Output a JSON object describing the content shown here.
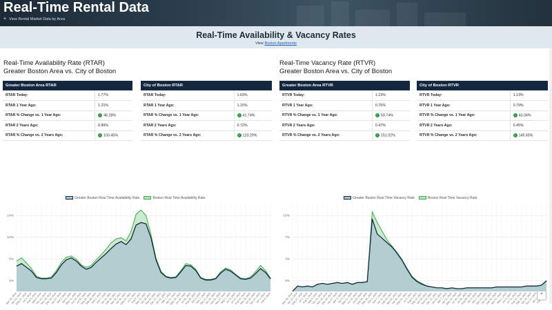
{
  "hero": {
    "title": "Real-Time Rental Data",
    "subtitle": "View Rental Market Data by Area"
  },
  "section": {
    "title": "Real-Time Availability & Vacancy Rates",
    "view_prefix": "View",
    "view_link": "Boston Apartments"
  },
  "rtar": {
    "heading_line1": "Real-Time Availability Rate (RTAR)",
    "heading_line2": "Greater Boston Area vs. City of Boston",
    "tables": [
      {
        "header": "Greater Boston Area RTAR",
        "rows": [
          {
            "label": "RTAR Today:",
            "value": "1.77%"
          },
          {
            "label": "RTAR 1 Year Ago:",
            "value": "1.21%"
          },
          {
            "label": "RTAR % Change vs. 1 Year Ago:",
            "value": "46.28%"
          },
          {
            "label": "RTAR 2 Years Ago:",
            "value": "0.86%"
          },
          {
            "label": "RTAR % Change vs. 2 Years Ago:",
            "value": "103.45%"
          }
        ]
      },
      {
        "header": "City of Boston RTAR",
        "rows": [
          {
            "label": "RTAR Today:",
            "value": "1.63%"
          },
          {
            "label": "RTAR 1 Year Ago:",
            "value": "1.15%"
          },
          {
            "label": "RTAR % Change vs. 1 Year Ago:",
            "value": "41.74%"
          },
          {
            "label": "RTAR 2 Years Ago:",
            "value": "0.72%"
          },
          {
            "label": "RTAR % Change vs. 2 Years Ago:",
            "value": "123.29%"
          }
        ]
      }
    ]
  },
  "rtvr": {
    "heading_line1": "Real-Time Vacancy Rate (RTVR)",
    "heading_line2": "Greater Boston Area vs. City of Boston",
    "tables": [
      {
        "header": "Greater Boston Area RTVR",
        "rows": [
          {
            "label": "RTVR Today:",
            "value": "1.23%"
          },
          {
            "label": "RTVR 1 Year Ago:",
            "value": "0.76%"
          },
          {
            "label": "RTVR % Change vs. 1 Year Ago:",
            "value": "59.74%"
          },
          {
            "label": "RTVR 2 Years Ago:",
            "value": "0.47%"
          },
          {
            "label": "RTVR % Change vs. 2 Years Ago:",
            "value": "151.02%"
          }
        ]
      },
      {
        "header": "City of Boston RTVR",
        "rows": [
          {
            "label": "RTVR Today:",
            "value": "1.13%"
          },
          {
            "label": "RTVR 1 Year Ago:",
            "value": "0.79%"
          },
          {
            "label": "RTVR % Change vs. 1 Year Ago:",
            "value": "43.04%"
          },
          {
            "label": "RTVR 2 Years Ago:",
            "value": "0.45%"
          },
          {
            "label": "RTVR % Change vs. 2 Years Ago:",
            "value": "145.65%"
          }
        ]
      }
    ]
  },
  "colors": {
    "greater_line": "#13283f",
    "greater_fill": "#a9c4d0",
    "boston_line": "#3daa4a",
    "boston_fill": "#b9e3bf",
    "table_header": "#13283f",
    "positive": "#2e9a44"
  },
  "chart_data": [
    {
      "type": "area",
      "ytick_labels": [
        "2%",
        "6%",
        "10%",
        "14%"
      ],
      "ylim": [
        0,
        14
      ],
      "grid": true,
      "legend_position": "top",
      "x": [
        "Mar 18, 2019",
        "Apr 22, 2019",
        "May 27, 2019",
        "Jul 1, 2019",
        "Aug 5, 2019",
        "Sep 9, 2019",
        "Oct 14, 2019",
        "Nov 18, 2019",
        "Dec 23, 2019",
        "Jan 27, 2020",
        "Mar 2, 2020",
        "Apr 6, 2020",
        "May 11, 2020",
        "Jun 15, 2020",
        "Jul 20, 2020",
        "Aug 24, 2020",
        "Sep 28, 2020",
        "Nov 2, 2020",
        "Dec 7, 2020",
        "Jan 11, 2021",
        "Feb 15, 2021",
        "Mar 22, 2021",
        "Apr 26, 2021",
        "May 31, 2021",
        "Jul 5, 2021",
        "Aug 9, 2021",
        "Sep 13, 2021",
        "Oct 18, 2021",
        "Nov 22, 2021",
        "Dec 27, 2021",
        "Jan 31, 2022",
        "Mar 7, 2022",
        "Apr 11, 2022",
        "May 16, 2022",
        "Jun 20, 2022",
        "Jul 25, 2022",
        "Aug 29, 2022",
        "Oct 3, 2022",
        "Nov 7, 2022",
        "Dec 12, 2022",
        "Jan 16, 2023",
        "Feb 20, 2023",
        "Mar 27, 2023",
        "May 1, 2023",
        "Jun 5, 2023",
        "Jul 10, 2023",
        "Aug 14, 2023",
        "Sep 18, 2023",
        "Oct 23, 2023",
        "Nov 27, 2023",
        "Jan 1, 2024",
        "Feb 5, 2024"
      ],
      "series": [
        {
          "name": "Greater Boston Real Time Availability Rate",
          "values": [
            4.0,
            4.4,
            3.8,
            3.2,
            2.2,
            2.0,
            2.0,
            2.1,
            3.0,
            4.2,
            5.0,
            5.3,
            4.8,
            4.0,
            3.5,
            3.8,
            4.6,
            5.3,
            6.0,
            6.8,
            7.5,
            7.9,
            7.4,
            8.3,
            10.5,
            10.9,
            10.7,
            8.5,
            5.0,
            3.0,
            2.3,
            2.1,
            2.2,
            3.1,
            4.1,
            4.0,
            3.3,
            2.1,
            1.8,
            1.8,
            2.0,
            2.9,
            3.5,
            3.2,
            2.6,
            2.0,
            1.9,
            2.1,
            2.8,
            3.6,
            3.0,
            2.0
          ]
        },
        {
          "name": "Boston Real Time Availability Rate",
          "values": [
            4.8,
            5.3,
            4.5,
            3.6,
            2.4,
            2.1,
            2.1,
            2.3,
            3.3,
            4.6,
            5.4,
            5.6,
            5.1,
            4.2,
            3.8,
            4.1,
            5.0,
            5.8,
            6.7,
            7.7,
            8.3,
            8.5,
            8.0,
            9.5,
            12.2,
            12.9,
            12.0,
            9.0,
            5.3,
            3.2,
            2.4,
            2.2,
            2.3,
            3.3,
            4.4,
            4.2,
            3.5,
            2.2,
            1.9,
            1.9,
            2.1,
            3.1,
            3.7,
            3.4,
            2.7,
            2.1,
            2.0,
            2.3,
            3.1,
            4.1,
            3.3,
            2.1
          ]
        }
      ]
    },
    {
      "type": "area",
      "ytick_labels": [
        "0%",
        "3%",
        "7%",
        "10%"
      ],
      "ylim": [
        0,
        10
      ],
      "grid": true,
      "legend_position": "top",
      "x": [
        "Mar 18, 2019",
        "Apr 22, 2019",
        "May 27, 2019",
        "Jul 1, 2019",
        "Aug 5, 2019",
        "Sep 9, 2019",
        "Oct 14, 2019",
        "Nov 18, 2019",
        "Dec 23, 2019",
        "Jan 27, 2020",
        "Mar 2, 2020",
        "Apr 6, 2020",
        "May 11, 2020",
        "Jun 15, 2020",
        "Jul 20, 2020",
        "Aug 24, 2020",
        "Sep 28, 2020",
        "Nov 2, 2020",
        "Dec 7, 2020",
        "Jan 11, 2021",
        "Feb 15, 2021",
        "Mar 22, 2021",
        "Apr 26, 2021",
        "May 31, 2021",
        "Jul 5, 2021",
        "Aug 9, 2021",
        "Sep 13, 2021",
        "Oct 18, 2021",
        "Nov 22, 2021",
        "Dec 27, 2021",
        "Jan 31, 2022",
        "Mar 7, 2022",
        "Apr 11, 2022",
        "May 16, 2022",
        "Jun 20, 2022",
        "Jul 25, 2022",
        "Aug 29, 2022",
        "Oct 3, 2022",
        "Nov 7, 2022",
        "Dec 12, 2022",
        "Jan 16, 2023",
        "Feb 20, 2023",
        "Mar 27, 2023",
        "May 1, 2023",
        "Jun 5, 2023",
        "Jul 10, 2023",
        "Aug 14, 2023",
        "Sep 18, 2023",
        "Oct 23, 2023",
        "Nov 27, 2023",
        "Jan 1, 2024",
        "Feb 5, 2024"
      ],
      "series": [
        {
          "name": "Greater Boston Real Time Vacancy Rate",
          "values": [
            0.0,
            0.6,
            0.5,
            0.6,
            0.5,
            0.8,
            0.9,
            0.8,
            0.9,
            1.0,
            0.9,
            1.0,
            0.8,
            1.0,
            1.0,
            1.1,
            8.2,
            6.5,
            6.0,
            5.5,
            5.0,
            4.3,
            3.5,
            2.5,
            1.6,
            1.1,
            0.8,
            0.6,
            0.5,
            0.4,
            0.4,
            0.3,
            0.4,
            0.3,
            0.3,
            0.4,
            0.4,
            0.4,
            0.4,
            0.4,
            0.4,
            0.5,
            0.5,
            0.5,
            0.5,
            0.5,
            0.5,
            0.6,
            0.6,
            0.6,
            0.7,
            1.2
          ]
        },
        {
          "name": "Boston Real Time Vacancy Rate",
          "values": [
            0.0,
            0.6,
            0.5,
            0.6,
            0.5,
            0.8,
            0.9,
            0.8,
            0.9,
            1.0,
            0.9,
            1.0,
            0.8,
            1.0,
            1.0,
            1.1,
            9.0,
            7.8,
            6.8,
            5.8,
            5.1,
            4.4,
            3.6,
            2.6,
            1.7,
            1.2,
            0.9,
            0.6,
            0.5,
            0.4,
            0.4,
            0.3,
            0.4,
            0.3,
            0.3,
            0.4,
            0.4,
            0.4,
            0.4,
            0.4,
            0.4,
            0.5,
            0.5,
            0.5,
            0.5,
            0.5,
            0.5,
            0.6,
            0.6,
            0.6,
            0.7,
            1.1
          ]
        }
      ]
    }
  ]
}
